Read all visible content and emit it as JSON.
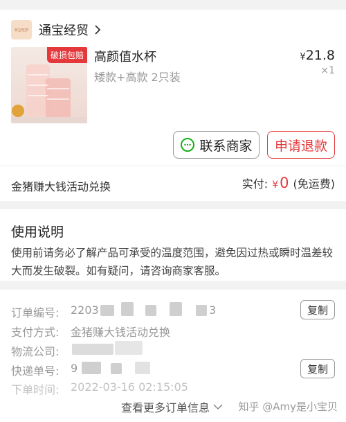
{
  "shop": {
    "name": "通宝经贸",
    "logo_text": "新宝旺梦"
  },
  "product": {
    "badge": "破损包赔",
    "title": "高颜值水杯",
    "spec": "矮款+高款 2只装",
    "currency": "¥",
    "price": "21.8",
    "qty": "×1"
  },
  "actions": {
    "contact": "联系商家",
    "refund": "申请退款"
  },
  "payment": {
    "activity": "金猪赚大钱活动兑换",
    "paid_label": "实付:",
    "currency": "¥",
    "paid_value": "0",
    "shipping": "(免运费)"
  },
  "instructions": {
    "heading": "使用说明",
    "body": "使用前请务必了解产品可承受的温度范围，避免因过热或瞬时温差较大而发生破裂。如有疑问，请咨询商家客服。"
  },
  "order": {
    "number_label": "订单编号:",
    "number_value_start": "2203",
    "number_value_end": "3",
    "payment_label": "支付方式:",
    "payment_value": "金猪赚大钱活动兑换",
    "logistics_label": "物流公司:",
    "tracking_label": "快递单号:",
    "tracking_value_start": "9",
    "time_label": "下单时间:",
    "time_value": "2022-03-16 02:15:05",
    "copy": "复制",
    "more": "查看更多订单信息"
  },
  "watermark": "知乎 @Amy是小宝贝",
  "colors": {
    "accent": "#e4393c",
    "wechat_green": "#1aad19",
    "background": "#f2f2f2"
  }
}
